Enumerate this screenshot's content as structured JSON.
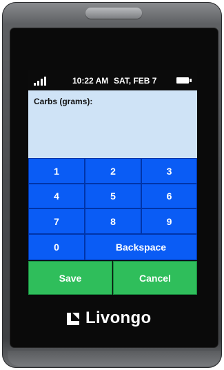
{
  "status_bar": {
    "time": "10:22 AM",
    "date": "SAT, FEB 7",
    "signal_icon": "signal-bars-icon",
    "battery_icon": "battery-icon"
  },
  "entry": {
    "label": "Carbs (grams):",
    "value": ""
  },
  "keypad": {
    "k1": "1",
    "k2": "2",
    "k3": "3",
    "k4": "4",
    "k5": "5",
    "k6": "6",
    "k7": "7",
    "k8": "8",
    "k9": "9",
    "k0": "0",
    "backspace": "Backspace"
  },
  "actions": {
    "save": "Save",
    "cancel": "Cancel"
  },
  "brand": {
    "name": "Livongo",
    "logo_icon": "livongo-logo-icon"
  },
  "colors": {
    "key_blue": "#0a5cf5",
    "action_green": "#2fbe5b",
    "entry_panel": "#cfe3f6",
    "screen_bg": "#0b0b0b"
  }
}
